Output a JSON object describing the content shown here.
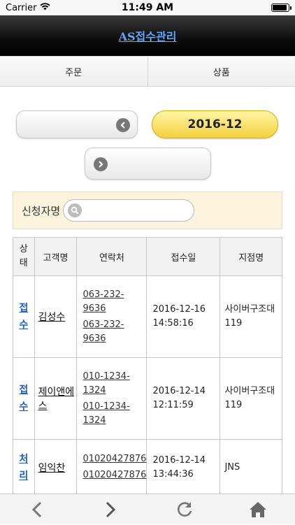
{
  "statusbar": {
    "carrier": "Carrier",
    "time": "11:49 AM"
  },
  "header": {
    "title": "AS접수관리"
  },
  "tabs": [
    {
      "label": "주문"
    },
    {
      "label": "상품"
    }
  ],
  "month_nav": {
    "prev_label": "",
    "current": "2016-12",
    "next_label": ""
  },
  "search": {
    "label": "신청자명",
    "value": "",
    "placeholder": ""
  },
  "table": {
    "headers": [
      "상\n태",
      "고객명",
      "연락처",
      "접수일",
      "지점명"
    ],
    "rows": [
      {
        "status": "접\n수",
        "customer": "김성수",
        "phone1": "063-232-9636",
        "phone2": "063-232-9636",
        "date": "2016-12-16 14:58:16",
        "branch": "사이버구조대 119"
      },
      {
        "status": "접\n수",
        "customer": "제이앤에스",
        "phone1": "010-1234-1324",
        "phone2": "010-1234-1324",
        "date": "2016-12-14 12:11:59",
        "branch": "사이버구조대 119"
      },
      {
        "status": "처\n리",
        "customer": "임익찬",
        "phone1": "01020427876",
        "phone2": "01020427876",
        "date": "2016-12-14 13:44:36",
        "branch": "JNS"
      }
    ]
  },
  "icons": {
    "wifi": "wifi-icon",
    "battery": "battery-icon",
    "prev": "chevron-left-icon",
    "next": "chevron-right-icon",
    "search": "search-icon",
    "back": "back-arrow-icon",
    "forward": "forward-arrow-icon",
    "reload": "reload-icon",
    "home": "home-icon"
  },
  "colors": {
    "accent_yellow": "#f5d23a",
    "link_blue": "#1a5bd8",
    "title_link": "#5aa8ff",
    "search_bg": "#fdf4de"
  }
}
